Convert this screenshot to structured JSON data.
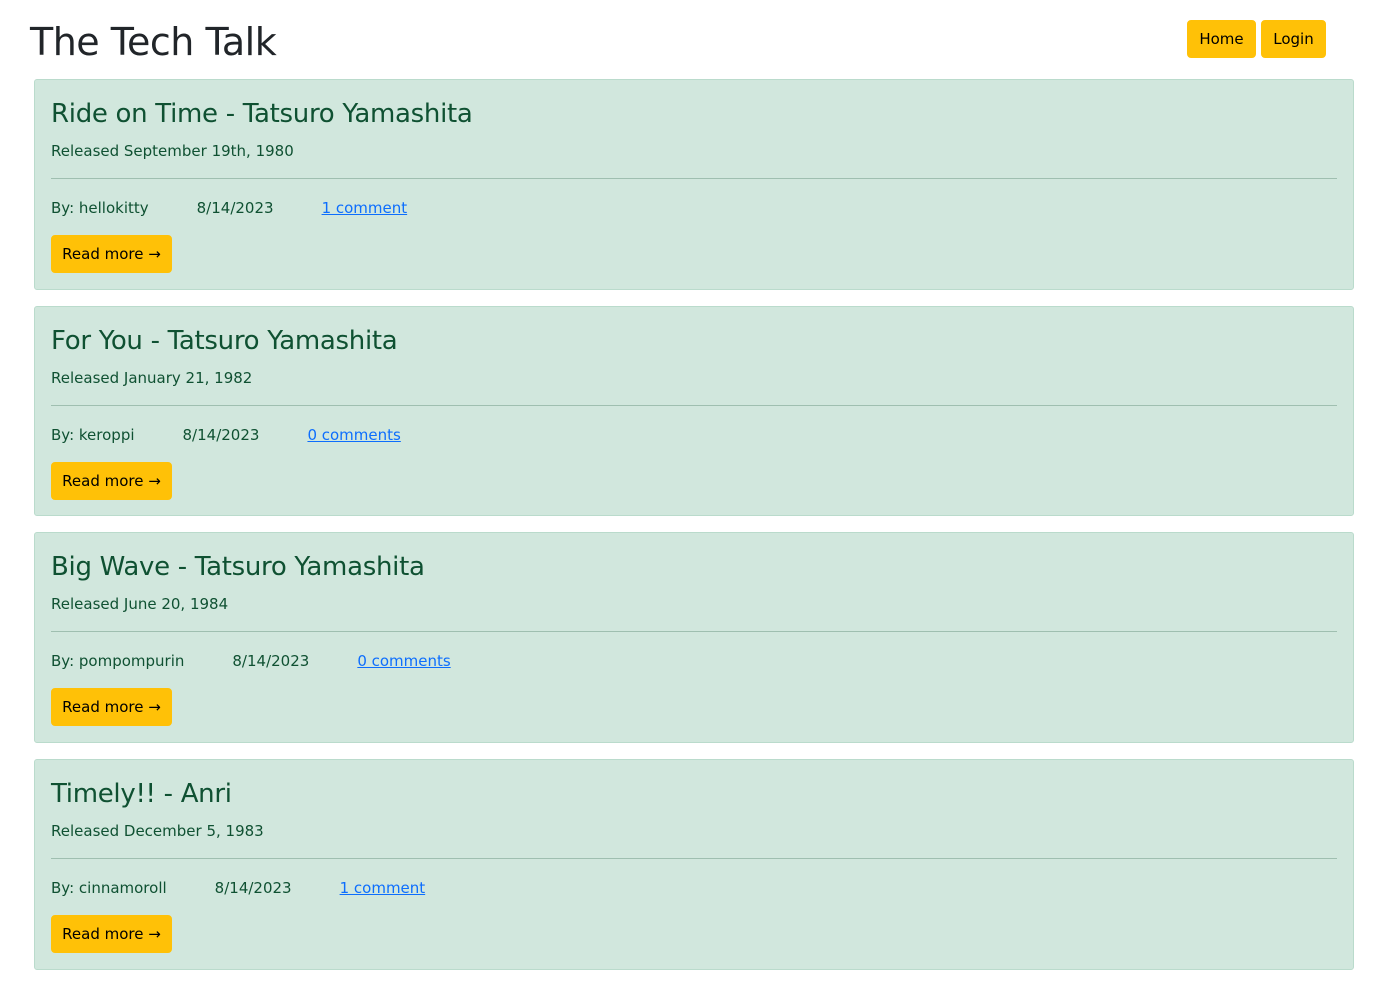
{
  "site": {
    "title": "The Tech Talk"
  },
  "nav": {
    "home_label": "Home",
    "login_label": "Login"
  },
  "colors": {
    "accent_button": "#ffc107",
    "card_background": "#d1e7dd",
    "card_text": "#0f5132",
    "link": "#0d6efd"
  },
  "posts": [
    {
      "title": "Ride on Time - Tatsuro Yamashita",
      "release": "Released September 19th, 1980",
      "author": "By: hellokitty",
      "date": "8/14/2023",
      "comments": "1 comment",
      "read_more": "Read more →"
    },
    {
      "title": "For You - Tatsuro Yamashita",
      "release": "Released January 21, 1982",
      "author": "By: keroppi",
      "date": "8/14/2023",
      "comments": "0 comments",
      "read_more": "Read more →"
    },
    {
      "title": "Big Wave - Tatsuro Yamashita",
      "release": "Released June 20, 1984",
      "author": "By: pompompurin",
      "date": "8/14/2023",
      "comments": "0 comments",
      "read_more": "Read more →"
    },
    {
      "title": "Timely!! - Anri",
      "release": "Released December 5, 1983",
      "author": "By: cinnamoroll",
      "date": "8/14/2023",
      "comments": "1 comment",
      "read_more": "Read more →"
    }
  ]
}
